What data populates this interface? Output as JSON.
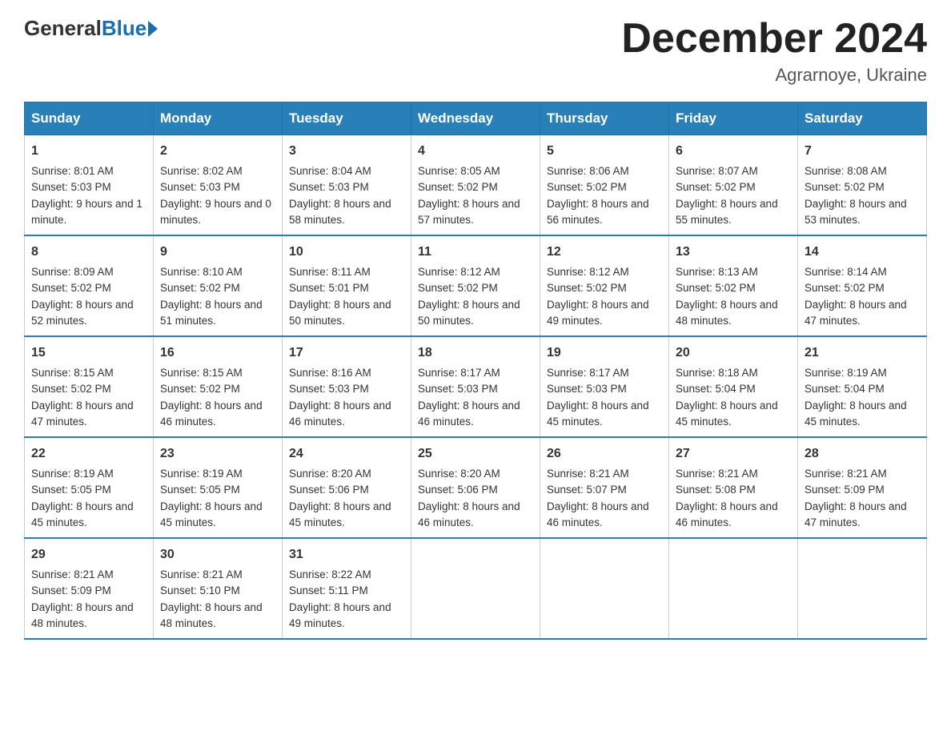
{
  "logo": {
    "general": "General",
    "blue": "Blue"
  },
  "title": "December 2024",
  "location": "Agrarnoye, Ukraine",
  "weekdays": [
    "Sunday",
    "Monday",
    "Tuesday",
    "Wednesday",
    "Thursday",
    "Friday",
    "Saturday"
  ],
  "weeks": [
    [
      {
        "day": "1",
        "sunrise": "8:01 AM",
        "sunset": "5:03 PM",
        "daylight": "9 hours and 1 minute."
      },
      {
        "day": "2",
        "sunrise": "8:02 AM",
        "sunset": "5:03 PM",
        "daylight": "9 hours and 0 minutes."
      },
      {
        "day": "3",
        "sunrise": "8:04 AM",
        "sunset": "5:03 PM",
        "daylight": "8 hours and 58 minutes."
      },
      {
        "day": "4",
        "sunrise": "8:05 AM",
        "sunset": "5:02 PM",
        "daylight": "8 hours and 57 minutes."
      },
      {
        "day": "5",
        "sunrise": "8:06 AM",
        "sunset": "5:02 PM",
        "daylight": "8 hours and 56 minutes."
      },
      {
        "day": "6",
        "sunrise": "8:07 AM",
        "sunset": "5:02 PM",
        "daylight": "8 hours and 55 minutes."
      },
      {
        "day": "7",
        "sunrise": "8:08 AM",
        "sunset": "5:02 PM",
        "daylight": "8 hours and 53 minutes."
      }
    ],
    [
      {
        "day": "8",
        "sunrise": "8:09 AM",
        "sunset": "5:02 PM",
        "daylight": "8 hours and 52 minutes."
      },
      {
        "day": "9",
        "sunrise": "8:10 AM",
        "sunset": "5:02 PM",
        "daylight": "8 hours and 51 minutes."
      },
      {
        "day": "10",
        "sunrise": "8:11 AM",
        "sunset": "5:01 PM",
        "daylight": "8 hours and 50 minutes."
      },
      {
        "day": "11",
        "sunrise": "8:12 AM",
        "sunset": "5:02 PM",
        "daylight": "8 hours and 50 minutes."
      },
      {
        "day": "12",
        "sunrise": "8:12 AM",
        "sunset": "5:02 PM",
        "daylight": "8 hours and 49 minutes."
      },
      {
        "day": "13",
        "sunrise": "8:13 AM",
        "sunset": "5:02 PM",
        "daylight": "8 hours and 48 minutes."
      },
      {
        "day": "14",
        "sunrise": "8:14 AM",
        "sunset": "5:02 PM",
        "daylight": "8 hours and 47 minutes."
      }
    ],
    [
      {
        "day": "15",
        "sunrise": "8:15 AM",
        "sunset": "5:02 PM",
        "daylight": "8 hours and 47 minutes."
      },
      {
        "day": "16",
        "sunrise": "8:15 AM",
        "sunset": "5:02 PM",
        "daylight": "8 hours and 46 minutes."
      },
      {
        "day": "17",
        "sunrise": "8:16 AM",
        "sunset": "5:03 PM",
        "daylight": "8 hours and 46 minutes."
      },
      {
        "day": "18",
        "sunrise": "8:17 AM",
        "sunset": "5:03 PM",
        "daylight": "8 hours and 46 minutes."
      },
      {
        "day": "19",
        "sunrise": "8:17 AM",
        "sunset": "5:03 PM",
        "daylight": "8 hours and 45 minutes."
      },
      {
        "day": "20",
        "sunrise": "8:18 AM",
        "sunset": "5:04 PM",
        "daylight": "8 hours and 45 minutes."
      },
      {
        "day": "21",
        "sunrise": "8:19 AM",
        "sunset": "5:04 PM",
        "daylight": "8 hours and 45 minutes."
      }
    ],
    [
      {
        "day": "22",
        "sunrise": "8:19 AM",
        "sunset": "5:05 PM",
        "daylight": "8 hours and 45 minutes."
      },
      {
        "day": "23",
        "sunrise": "8:19 AM",
        "sunset": "5:05 PM",
        "daylight": "8 hours and 45 minutes."
      },
      {
        "day": "24",
        "sunrise": "8:20 AM",
        "sunset": "5:06 PM",
        "daylight": "8 hours and 45 minutes."
      },
      {
        "day": "25",
        "sunrise": "8:20 AM",
        "sunset": "5:06 PM",
        "daylight": "8 hours and 46 minutes."
      },
      {
        "day": "26",
        "sunrise": "8:21 AM",
        "sunset": "5:07 PM",
        "daylight": "8 hours and 46 minutes."
      },
      {
        "day": "27",
        "sunrise": "8:21 AM",
        "sunset": "5:08 PM",
        "daylight": "8 hours and 46 minutes."
      },
      {
        "day": "28",
        "sunrise": "8:21 AM",
        "sunset": "5:09 PM",
        "daylight": "8 hours and 47 minutes."
      }
    ],
    [
      {
        "day": "29",
        "sunrise": "8:21 AM",
        "sunset": "5:09 PM",
        "daylight": "8 hours and 48 minutes."
      },
      {
        "day": "30",
        "sunrise": "8:21 AM",
        "sunset": "5:10 PM",
        "daylight": "8 hours and 48 minutes."
      },
      {
        "day": "31",
        "sunrise": "8:22 AM",
        "sunset": "5:11 PM",
        "daylight": "8 hours and 49 minutes."
      },
      null,
      null,
      null,
      null
    ]
  ],
  "labels": {
    "sunrise": "Sunrise:",
    "sunset": "Sunset:",
    "daylight": "Daylight:"
  }
}
